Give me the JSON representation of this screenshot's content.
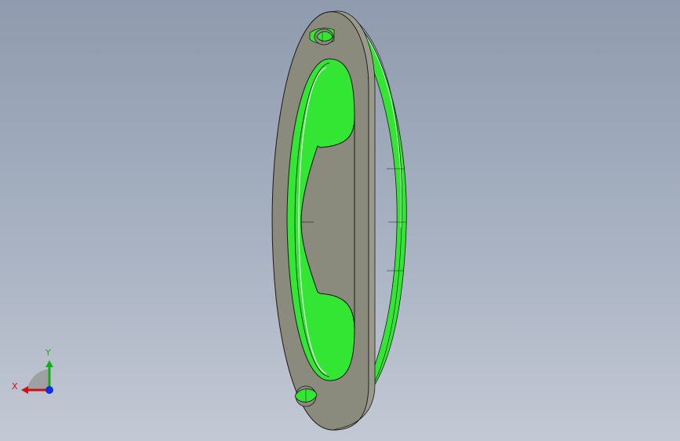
{
  "viewport": {
    "background_top": "#8f9bae",
    "background_bottom": "#c3c9d4"
  },
  "model": {
    "part_face_color": "#8b8b7d",
    "highlight_color": "#33e633",
    "edge_color": "#1a1a1a"
  },
  "triad": {
    "x_label": "X",
    "y_label": "Y",
    "x_color": "#d01010",
    "y_color": "#10b010",
    "z_color": "#1030e0"
  }
}
